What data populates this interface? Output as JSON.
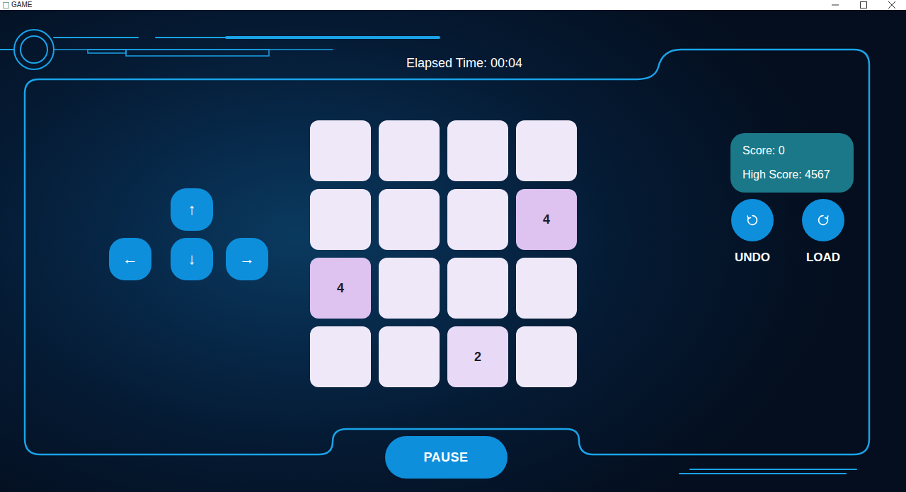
{
  "window": {
    "title": "GAME"
  },
  "elapsed": {
    "label": "Elapsed Time: 00:04"
  },
  "controls": [
    {
      "label": "↑"
    },
    {
      "label": "←"
    },
    {
      "label": "↓"
    },
    {
      "label": "→"
    }
  ],
  "board": {
    "rows": [
      [
        "",
        "",
        "",
        ""
      ],
      [
        "",
        "",
        "",
        "4"
      ],
      [
        "4",
        "",
        "",
        ""
      ],
      [
        "",
        "",
        "2",
        ""
      ]
    ]
  },
  "score": {
    "score": "Score: 0",
    "high_score": "High Score: 4567"
  },
  "actions": [
    {
      "label": "UNDO"
    },
    {
      "label": "LOAD"
    }
  ],
  "pause": {
    "label": "PAUSE"
  }
}
